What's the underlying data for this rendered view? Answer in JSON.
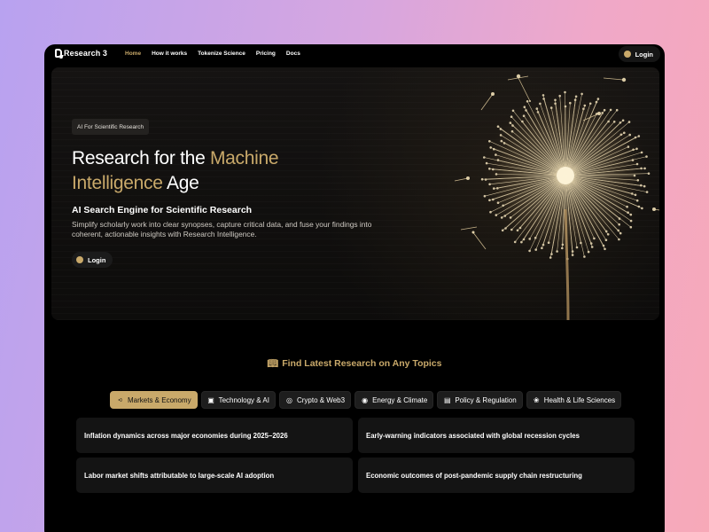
{
  "nav": {
    "logo": "Research 3",
    "links": [
      "Home",
      "How it works",
      "Tokenize Science",
      "Pricing",
      "Docs"
    ],
    "login": "Login"
  },
  "hero": {
    "badge": "AI For Scientific Research",
    "title_part1": "Research for the ",
    "title_gold1": "Machine",
    "title_gold2": "Intelligence",
    "title_part2": " Age",
    "subtitle": "AI Search Engine for Scientific Research",
    "description": "Simplify scholarly work into clear synopses, capture critical data, and fuse your findings into coherent, actionable insights with Research Intelligence.",
    "login": "Login"
  },
  "topics": {
    "heading": "Find Latest Research on Any Topics",
    "tabs": [
      {
        "label": "Markets & Economy",
        "icon": "chart-icon"
      },
      {
        "label": "Technology & AI",
        "icon": "ai-icon"
      },
      {
        "label": "Crypto & Web3",
        "icon": "coin-icon"
      },
      {
        "label": "Energy & Climate",
        "icon": "globe-icon"
      },
      {
        "label": "Policy & Regulation",
        "icon": "document-icon"
      },
      {
        "label": "Health & Life Sciences",
        "icon": "molecule-icon"
      }
    ],
    "active_tab": "Markets & Economy",
    "cards": [
      "Inflation dynamics across major economies during 2025–2026",
      "Early-warning indicators associated with global recession cycles",
      "Labor market shifts attributable to large-scale AI adoption",
      "Economic outcomes of post-pandemic supply chain restructuring"
    ]
  },
  "colors": {
    "accent": "#c9a96a",
    "background": "#000000",
    "card": "#141414"
  }
}
